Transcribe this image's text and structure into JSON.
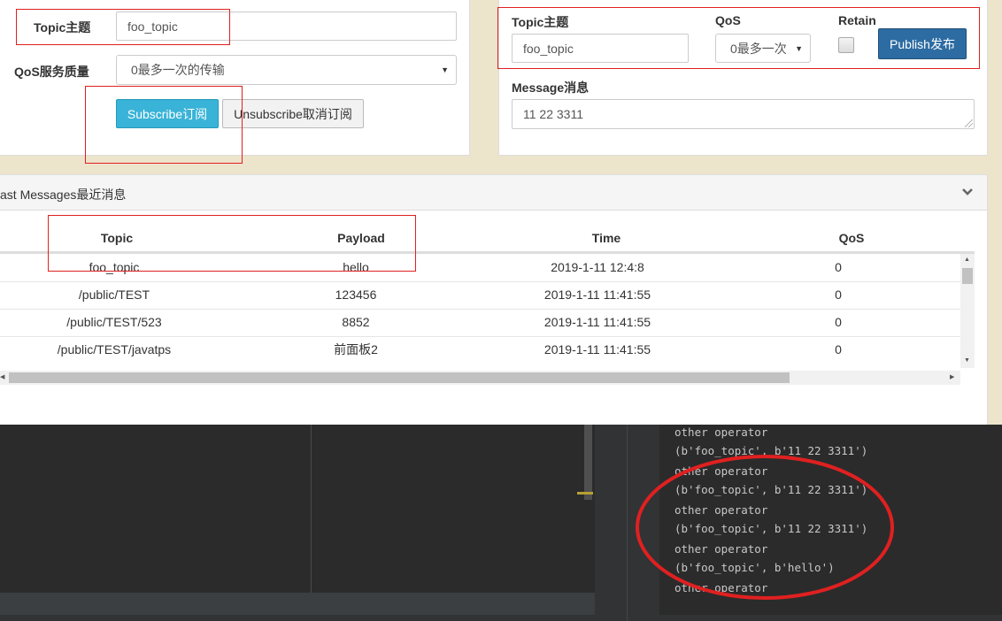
{
  "subscribe": {
    "topic_label": "Topic主题",
    "topic_value": "foo_topic",
    "qos_label": "QoS服务质量",
    "qos_value": "0最多一次的传输",
    "subscribe_button": "Subscribe订阅",
    "unsubscribe_button": "Unsubscribe取消订阅"
  },
  "publish": {
    "topic_label": "Topic主题",
    "topic_value": "foo_topic",
    "qos_label": "QoS",
    "qos_value": "0最多一次",
    "retain_label": "Retain",
    "publish_button": "Publish发布",
    "message_label": "Message消息",
    "message_value": "11 22 3311"
  },
  "messages": {
    "title": "ast Messages最近消息",
    "columns": [
      "Topic",
      "Payload",
      "Time",
      "QoS"
    ],
    "rows": [
      [
        "foo_topic",
        "hello",
        "2019-1-11 12:4:8",
        "0"
      ],
      [
        "/public/TEST",
        "123456",
        "2019-1-11 11:41:55",
        "0"
      ],
      [
        "/public/TEST/523",
        "8852",
        "2019-1-11 11:41:55",
        "0"
      ],
      [
        "/public/TEST/javatps",
        "前面板2",
        "2019-1-11 11:41:55",
        "0"
      ]
    ]
  },
  "console": {
    "lines": [
      "other operator",
      "(b'foo_topic', b'11 22 3311')",
      "other operator",
      "(b'foo_topic', b'11 22 3311')",
      "other operator",
      "(b'foo_topic', b'11 22 3311')",
      "other operator",
      "(b'foo_topic', b'hello')",
      "other operator"
    ]
  },
  "colors": {
    "background": "#ede4cc",
    "subscribe_button": "#39b3d7",
    "publish_button": "#2d6ca2",
    "annotation_red": "#e02020",
    "console_bg": "#2b2b2b"
  }
}
